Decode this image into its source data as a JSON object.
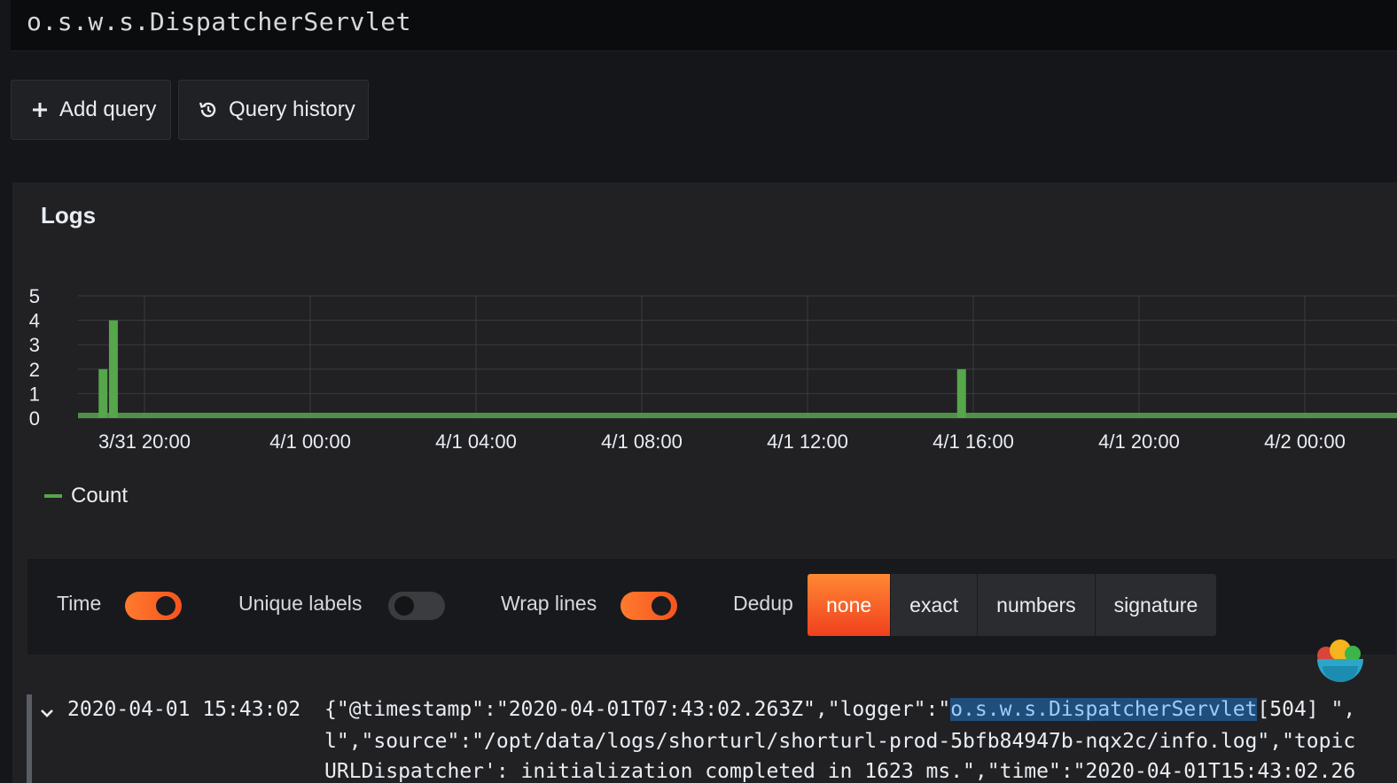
{
  "query": {
    "text": "o.s.w.s.DispatcherServlet"
  },
  "toolbar": {
    "add_query_label": "Add query",
    "add_query_icon": "plus-icon",
    "query_history_label": "Query history",
    "query_history_icon": "history-icon"
  },
  "panel": {
    "title": "Logs"
  },
  "chart_data": {
    "type": "bar",
    "y_ticks": [
      "0",
      "1",
      "2",
      "3",
      "4",
      "5"
    ],
    "ylim": [
      0,
      5
    ],
    "x_ticks": [
      "3/31 20:00",
      "4/1 00:00",
      "4/1 04:00",
      "4/1 08:00",
      "4/1 12:00",
      "4/1 16:00",
      "4/1 20:00",
      "4/2 00:00"
    ],
    "series": [
      {
        "name": "Count",
        "color": "#56a64b",
        "points": [
          {
            "x": "3/31 19:00",
            "value": 2
          },
          {
            "x": "3/31 19:15",
            "value": 4
          },
          {
            "x": "4/1 15:43",
            "value": 2
          }
        ]
      }
    ],
    "grid": true,
    "legend": "bottom-left"
  },
  "options": {
    "time_label": "Time",
    "time_on": true,
    "unique_labels_label": "Unique labels",
    "unique_labels_on": false,
    "wrap_lines_label": "Wrap lines",
    "wrap_lines_on": true,
    "dedup_label": "Dedup",
    "dedup_options": [
      "none",
      "exact",
      "numbers",
      "signature"
    ],
    "dedup_selected": "none"
  },
  "log": {
    "timestamp": "2020-04-01 15:43:02",
    "line1_pre": "{\"@timestamp\":\"2020-04-01T07:43:02.263Z\",\"logger\":\"",
    "line1_match": "o.s.w.s.DispatcherServlet",
    "line1_post": "[504] \",",
    "line2": "l\",\"source\":\"/opt/data/logs/shorturl/shorturl-prod-5bfb84947b-nqx2c/info.log\",\"topic",
    "line3": "URLDispatcher': initialization completed in 1623 ms.\",\"time\":\"2020-04-01T15:43:02.26"
  },
  "colors": {
    "accent": "#f5541d",
    "series": "#56a64b",
    "highlight": "#1f4e7a"
  }
}
